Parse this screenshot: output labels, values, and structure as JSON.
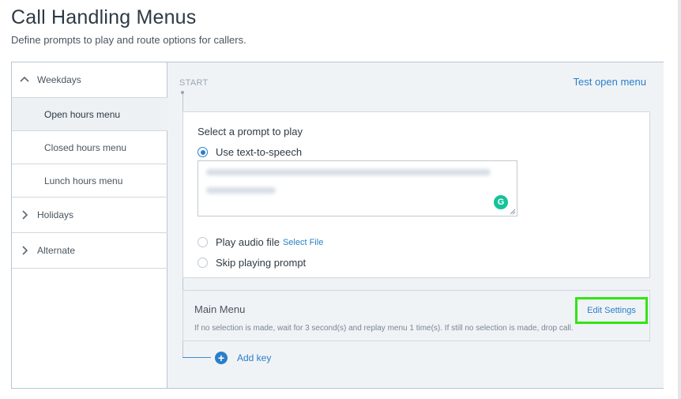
{
  "header": {
    "title": "Call Handling Menus",
    "subtitle": "Define prompts to play and route options for callers."
  },
  "sidebar": {
    "groups": [
      {
        "label": "Weekdays",
        "icon": "chevron-up-icon",
        "expanded": true,
        "items": [
          {
            "label": "Open hours menu",
            "active": true
          },
          {
            "label": "Closed hours menu",
            "active": false
          },
          {
            "label": "Lunch hours menu",
            "active": false
          }
        ]
      },
      {
        "label": "Holidays",
        "icon": "chevron-right-icon",
        "expanded": false
      },
      {
        "label": "Alternate",
        "icon": "chevron-right-icon",
        "expanded": false
      }
    ]
  },
  "flow": {
    "start_label": "START",
    "test_link": "Test open menu",
    "prompt": {
      "title": "Select a prompt to play",
      "options": {
        "tts": "Use text-to-speech",
        "audio": "Play audio file",
        "audio_link": "Select File",
        "skip": "Skip playing prompt"
      },
      "selected": "tts"
    },
    "main_menu": {
      "title": "Main Menu",
      "edit_label": "Edit Settings",
      "description": "If no selection is made, wait for 3 second(s) and replay menu 1 time(s). If still no selection is made, drop call."
    },
    "add_key": "Add key"
  },
  "colors": {
    "accent": "#2a7fc9",
    "highlight": "#33e416",
    "panel": "#f0f3f6"
  }
}
